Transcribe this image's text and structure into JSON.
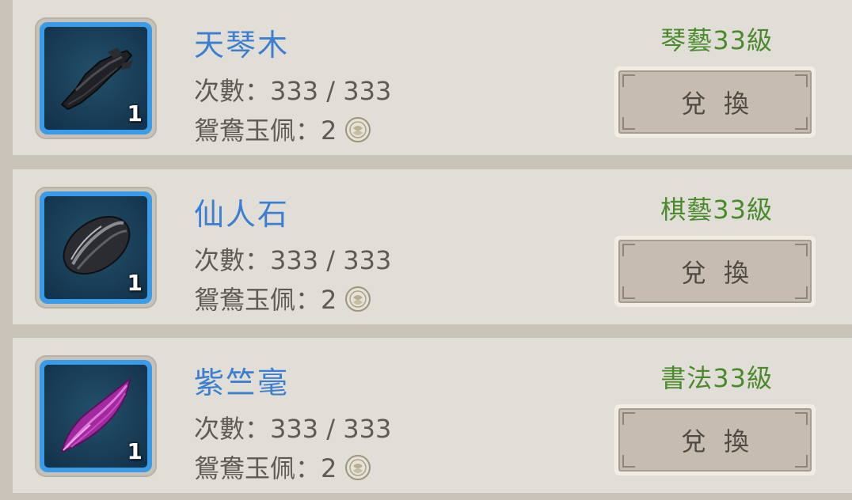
{
  "items": [
    {
      "name": "天琴木",
      "icon": "black-wood-icon",
      "quantity": "1",
      "count_label": "次數：",
      "count_value": "333 / 333",
      "cost_label": "鴛鴦玉佩：",
      "cost_value": "2",
      "cost_icon": "jade-coin-icon",
      "requirement": "琴藝33級",
      "button_label": "兌換"
    },
    {
      "name": "仙人石",
      "icon": "black-stone-icon",
      "quantity": "1",
      "count_label": "次數：",
      "count_value": "333 / 333",
      "cost_label": "鴛鴦玉佩：",
      "cost_value": "2",
      "cost_icon": "jade-coin-icon",
      "requirement": "棋藝33級",
      "button_label": "兌換"
    },
    {
      "name": "紫竺毫",
      "icon": "purple-brush-icon",
      "quantity": "1",
      "count_label": "次數：",
      "count_value": "333 / 333",
      "cost_label": "鴛鴦玉佩：",
      "cost_value": "2",
      "cost_icon": "jade-coin-icon",
      "requirement": "書法33級",
      "button_label": "兌換"
    }
  ],
  "colors": {
    "name": "#3c7fd0",
    "requirement": "#4b8a2c",
    "icon_border": "#3a9be8"
  }
}
